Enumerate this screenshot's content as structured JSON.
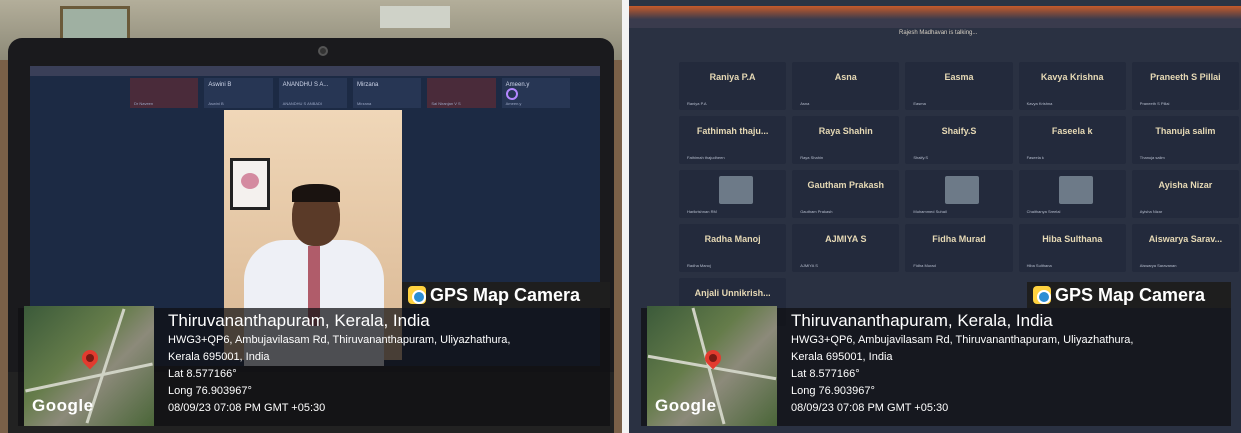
{
  "gps": {
    "badge_label": "GPS Map Camera",
    "map_brand": "Google",
    "place": "Thiruvananthapuram, Kerala, India",
    "address_line1": "HWG3+QP6, Ambujavilasam Rd, Thiruvananthapuram, Uliyazhathura,",
    "address_line2": "Kerala 695001, India",
    "lat": "Lat 8.577166°",
    "long": "Long 76.903967°",
    "timestamp": "08/09/23 07:08 PM GMT +05:30"
  },
  "left_meeting": {
    "participants": [
      {
        "name": "",
        "sub": "Dr Naveen"
      },
      {
        "name": "Aswini B",
        "sub": "Aswini B"
      },
      {
        "name": "ANANDHU S A...",
        "sub": "ANANDHU S ANBADI"
      },
      {
        "name": "Mirzana",
        "sub": "Mirzana"
      },
      {
        "name": "",
        "sub": "Sai Niranjan V S"
      },
      {
        "name": "Ameen.y",
        "sub": "Ameen.y"
      }
    ]
  },
  "right_meeting": {
    "talking": "Rajesh Madhavan is talking...",
    "participants": [
      {
        "name": "Raniya P.A",
        "sub": "Raniya P.A"
      },
      {
        "name": "Asna",
        "sub": "Asna"
      },
      {
        "name": "Easma",
        "sub": "Easma"
      },
      {
        "name": "Kavya Krishna",
        "sub": "Kavya Krishna"
      },
      {
        "name": "Praneeth S Pillai",
        "sub": "Praneeth S Pillai"
      },
      {
        "name": "Fathimah thaju...",
        "sub": "Fathimah thajudheen"
      },
      {
        "name": "Raya Shahin",
        "sub": "Raya Shahin"
      },
      {
        "name": "Shaify.S",
        "sub": "Shaify.S"
      },
      {
        "name": "Faseela k",
        "sub": "Faseela k"
      },
      {
        "name": "Thanuja salim",
        "sub": "Thanuja salim"
      },
      {
        "name": "",
        "sub": "Harikrishnan RM"
      },
      {
        "name": "Gautham Prakash",
        "sub": "Gautham Prakash"
      },
      {
        "name": "",
        "sub": "Muhammed Suhail"
      },
      {
        "name": "",
        "sub": "Chaithanya Sreelal"
      },
      {
        "name": "Ayisha Nizar",
        "sub": "Ayisha Nizar"
      },
      {
        "name": "Radha Manoj",
        "sub": "Radha Manoj"
      },
      {
        "name": "AJMIYA S",
        "sub": "AJMIYA S"
      },
      {
        "name": "Fidha Murad",
        "sub": "Fidha Murad"
      },
      {
        "name": "Hiba Sulthana",
        "sub": "Hiba Sulthana"
      },
      {
        "name": "Aiswarya Sarav...",
        "sub": "Aiswarya Saravanan"
      },
      {
        "name": "Anjali Unnikrish...",
        "sub": ""
      }
    ]
  }
}
